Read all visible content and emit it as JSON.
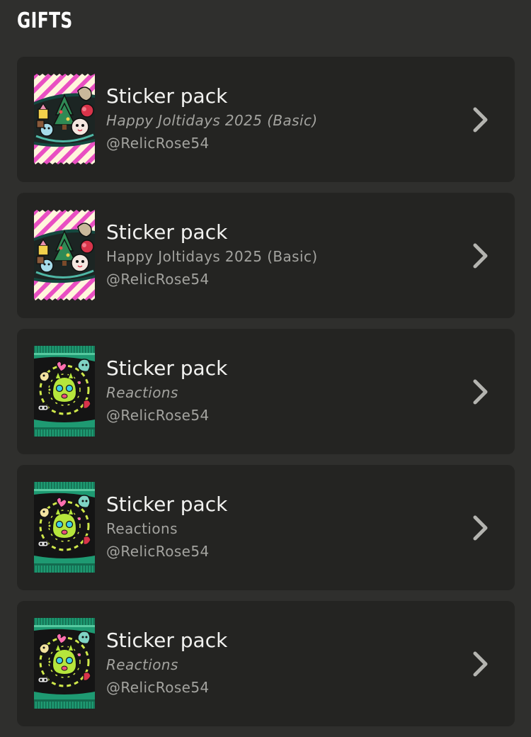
{
  "header": {
    "title": "GIFTS"
  },
  "gifts": [
    {
      "type_label": "Sticker pack",
      "pack_name": "Happy Joltidays 2025 (Basic)",
      "sender": "@RelicRose54",
      "icon": "holiday-sticker-pack-icon"
    },
    {
      "type_label": "Sticker pack",
      "pack_name": "Happy Joltidays 2025 (Basic)",
      "sender": "@RelicRose54",
      "icon": "holiday-sticker-pack-icon"
    },
    {
      "type_label": "Sticker pack",
      "pack_name": "Reactions",
      "sender": "@RelicRose54",
      "icon": "reactions-sticker-pack-icon"
    },
    {
      "type_label": "Sticker pack",
      "pack_name": "Reactions",
      "sender": "@RelicRose54",
      "icon": "reactions-sticker-pack-icon"
    },
    {
      "type_label": "Sticker pack",
      "pack_name": "Reactions",
      "sender": "@RelicRose54",
      "icon": "reactions-sticker-pack-icon"
    }
  ],
  "colors": {
    "background": "#2f2f2d",
    "card": "#242422",
    "primary_text": "#f2f2f0",
    "secondary_text": "#a3a39f",
    "chevron": "#b4b4b0",
    "holiday_stripe": "#e94fc2",
    "reactions_green": "#1e9a72"
  }
}
